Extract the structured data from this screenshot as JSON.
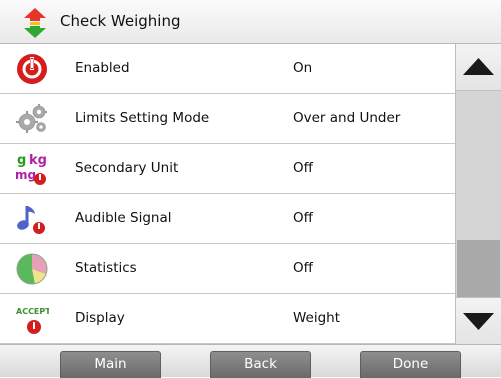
{
  "header": {
    "title": "Check Weighing",
    "icon": "check-weighing-arrows-icon"
  },
  "rows": [
    {
      "label": "Enabled",
      "value": "On",
      "icon": "power-icon"
    },
    {
      "label": "Limits Setting Mode",
      "value": "Over and Under",
      "icon": "gears-icon"
    },
    {
      "label": "Secondary Unit",
      "value": "Off",
      "icon": "units-icon",
      "icon_text": {
        "g": "g",
        "kg": "kg",
        "mg": "mg"
      }
    },
    {
      "label": "Audible Signal",
      "value": "Off",
      "icon": "music-note-icon"
    },
    {
      "label": "Statistics",
      "value": "Off",
      "icon": "pie-chart-icon"
    },
    {
      "label": "Display",
      "value": "Weight",
      "icon": "accept-icon",
      "icon_text": "ACCEPT"
    }
  ],
  "footer": {
    "main": "Main",
    "back": "Back",
    "done": "Done"
  },
  "colors": {
    "power_red": "#d41e1e",
    "units_green": "#2a9a1f",
    "units_magenta": "#b21fa8",
    "note_blue": "#4e63c9",
    "accept_green": "#3d8f2f"
  }
}
